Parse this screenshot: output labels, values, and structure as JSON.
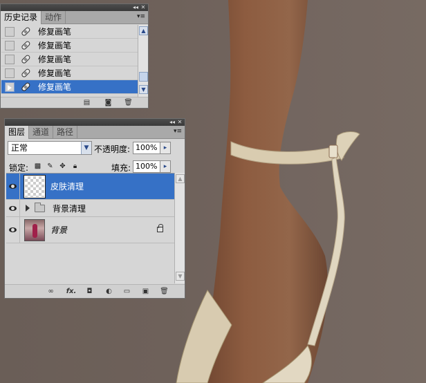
{
  "history_panel": {
    "tabs": [
      {
        "label": "历史记录",
        "active": true
      },
      {
        "label": "动作",
        "active": false
      }
    ],
    "items": [
      {
        "label": "修复画笔",
        "selected": false
      },
      {
        "label": "修复画笔",
        "selected": false
      },
      {
        "label": "修复画笔",
        "selected": false
      },
      {
        "label": "修复画笔",
        "selected": false
      },
      {
        "label": "修复画笔",
        "selected": true
      }
    ],
    "footer_icons": [
      "new-document-from-state-icon",
      "camera-snapshot-icon",
      "trash-icon"
    ]
  },
  "layers_panel": {
    "tabs": [
      {
        "label": "图层",
        "active": true
      },
      {
        "label": "通道",
        "active": false
      },
      {
        "label": "路径",
        "active": false
      }
    ],
    "blend_mode": "正常",
    "opacity_label": "不透明度:",
    "opacity_value": "100%",
    "lock_label": "锁定:",
    "fill_label": "填充:",
    "fill_value": "100%",
    "layers": [
      {
        "name": "皮肤清理",
        "type": "layer",
        "selected": true,
        "visible": true,
        "locked": false
      },
      {
        "name": "背景清理",
        "type": "group",
        "selected": false,
        "visible": true,
        "locked": false
      },
      {
        "name": "背景",
        "type": "background",
        "selected": false,
        "visible": true,
        "locked": true
      }
    ],
    "footer_icons": [
      "link-icon",
      "fx-icon",
      "mask-icon",
      "adjustment-icon",
      "group-folder-icon",
      "new-layer-icon",
      "trash-icon"
    ],
    "footer_fx_label": "fx."
  },
  "colors": {
    "selection": "#3671c6",
    "panel_bg": "#d6d6d6",
    "titlebar": "#3e3e3e",
    "canvas_bg": "#6e625b",
    "skin": "#8a5a3e",
    "strap": "#d9ccb0"
  }
}
